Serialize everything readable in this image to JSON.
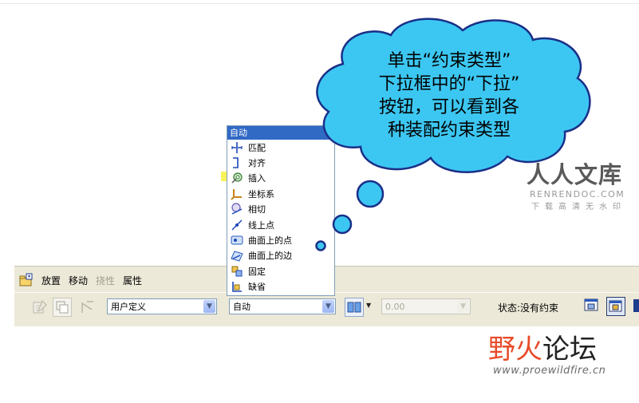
{
  "callout": {
    "lines": [
      "单击“约束类型”",
      "下拉框中的“下拉”",
      "按钮，可以看到各",
      "种装配约束类型"
    ]
  },
  "watermark_top": {
    "title": "人人文库",
    "en": "RENRENDOC.COM",
    "sub": "下载高清无水印"
  },
  "watermark_bottom": {
    "title_a": "野火",
    "title_b": "论坛",
    "url": "www.proewildfire.cn"
  },
  "dashboard": {
    "tabs": [
      {
        "label": "放置",
        "disabled": false
      },
      {
        "label": "移动",
        "disabled": false
      },
      {
        "label": "挠性",
        "disabled": true
      },
      {
        "label": "属性",
        "disabled": false
      }
    ],
    "user_def_combo": "用户定义",
    "constraint_combo": "自动",
    "offset_combo": "0.00",
    "status": "状态:没有约束"
  },
  "dropdown": {
    "header": "自动",
    "items": [
      {
        "label": "匹配",
        "icon": "mate-icon"
      },
      {
        "label": "对齐",
        "icon": "align-icon"
      },
      {
        "label": "插入",
        "icon": "insert-icon"
      },
      {
        "label": "坐标系",
        "icon": "coord-sys-icon"
      },
      {
        "label": "相切",
        "icon": "tangent-icon"
      },
      {
        "label": "线上点",
        "icon": "point-on-line-icon"
      },
      {
        "label": "曲面上的点",
        "icon": "point-on-surface-icon"
      },
      {
        "label": "曲面上的边",
        "icon": "edge-on-surface-icon"
      },
      {
        "label": "固定",
        "icon": "fix-icon"
      },
      {
        "label": "缺省",
        "icon": "default-icon"
      }
    ]
  },
  "colors": {
    "cloud_fill": "#3cc7f2",
    "cloud_stroke": "#1a2f88",
    "selection_blue": "#316ac5",
    "highlight_yellow": "#f5f23c",
    "toolbar_bg": "#ece9d8"
  }
}
